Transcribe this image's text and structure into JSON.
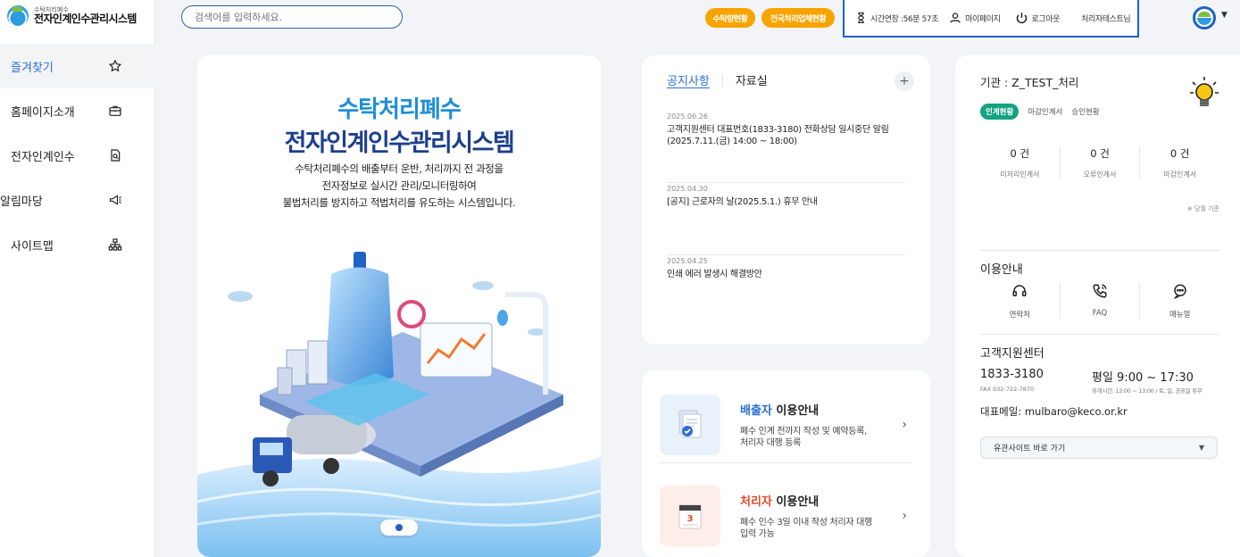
{
  "logo": {
    "small": "수탁처리폐수",
    "big": "전자인계인수관리시스템"
  },
  "sidebar": {
    "items": [
      {
        "label": "즐겨찾기",
        "icon": "star-icon"
      },
      {
        "label": "홈페이지소개",
        "icon": "briefcase-icon"
      },
      {
        "label": "전자인계인수",
        "icon": "document-search-icon"
      },
      {
        "label": "알림마당",
        "icon": "megaphone-icon"
      },
      {
        "label": "사이트맵",
        "icon": "sitemap-icon"
      }
    ]
  },
  "header": {
    "search_placeholder": "검색어를 입력하세요.",
    "pill_1": "수탁량현황",
    "pill_2": "전국처리업체현황",
    "session_label": "시간연장 :56분 57초",
    "mypage_label": "마이페이지",
    "logout_label": "로그아웃",
    "user_label": "처리자테스트님",
    "accent_color": "#f7a400"
  },
  "hero": {
    "title_1": "수탁처리폐수",
    "title_2": "전자인계인수관리시스템",
    "desc_1": "수탁처리폐수의 배출부터 운반, 처리까지 전 과정을",
    "desc_2": "전자정보로 실시간 관리/모니터링하여",
    "desc_3": "불법처리를 방지하고 적법처리를 유도하는 시스템입니다."
  },
  "notice": {
    "tab_notice": "공지사항",
    "tab_data": "자료실",
    "plus": "+",
    "items": [
      {
        "date": "2025.06.26",
        "text_1": "고객지원센터 대표번호(1833-3180) 전화상담 일시중단 알림",
        "text_2": "(2025.7.11.(금) 14:00 ~ 18:00)"
      },
      {
        "date": "2025.04.30",
        "text_1": "[공지] 근로자의 날(2025.5.1.) 휴무 안내",
        "text_2": ""
      },
      {
        "date": "2025.04.25",
        "text_1": "인쇄 에러 발생시 해결방안",
        "text_2": ""
      }
    ]
  },
  "guide": {
    "discharger": {
      "title_em": "배출자",
      "title_rest": " 이용안내",
      "desc": "폐수 인계 전까지 작성 및 예약등록, 처리자 대행 등록"
    },
    "processor": {
      "title_em": "처리자",
      "title_rest": " 이용안내",
      "desc": "폐수 인수 3일 이내 작성 처리자 대행 입력 가능"
    },
    "arrow": "›"
  },
  "right_panel": {
    "org": "기관 : Z_TEST_처리",
    "tabs": [
      "인계현황",
      "마감인계서",
      "승인현황"
    ],
    "stats": [
      {
        "value": "0 건",
        "label": "미처리인계서"
      },
      {
        "value": "0 건",
        "label": "오류인계서"
      },
      {
        "value": "0 건",
        "label": "마감인계서"
      }
    ],
    "stat_note": "※ 당월 기준",
    "usage_title": "이용안내",
    "usage": [
      {
        "label": "연락처",
        "icon": "headset-icon"
      },
      {
        "label": "FAQ",
        "icon": "phone-icon"
      },
      {
        "label": "매뉴얼",
        "icon": "chat-icon"
      }
    ],
    "cs_title": "고객지원센터",
    "cs_phone": "1833-3180",
    "cs_fax": "FAX 032-722-7870",
    "cs_hours": "평일 9:00 ~ 17:30",
    "cs_hours_note": "휴게시간: 12:00 ~ 13:00 / 토, 일, 공휴일 휴무",
    "cs_mail": "대표메일: mulbaro@keco.or.kr",
    "related": "유관사이트 바로 가기"
  }
}
